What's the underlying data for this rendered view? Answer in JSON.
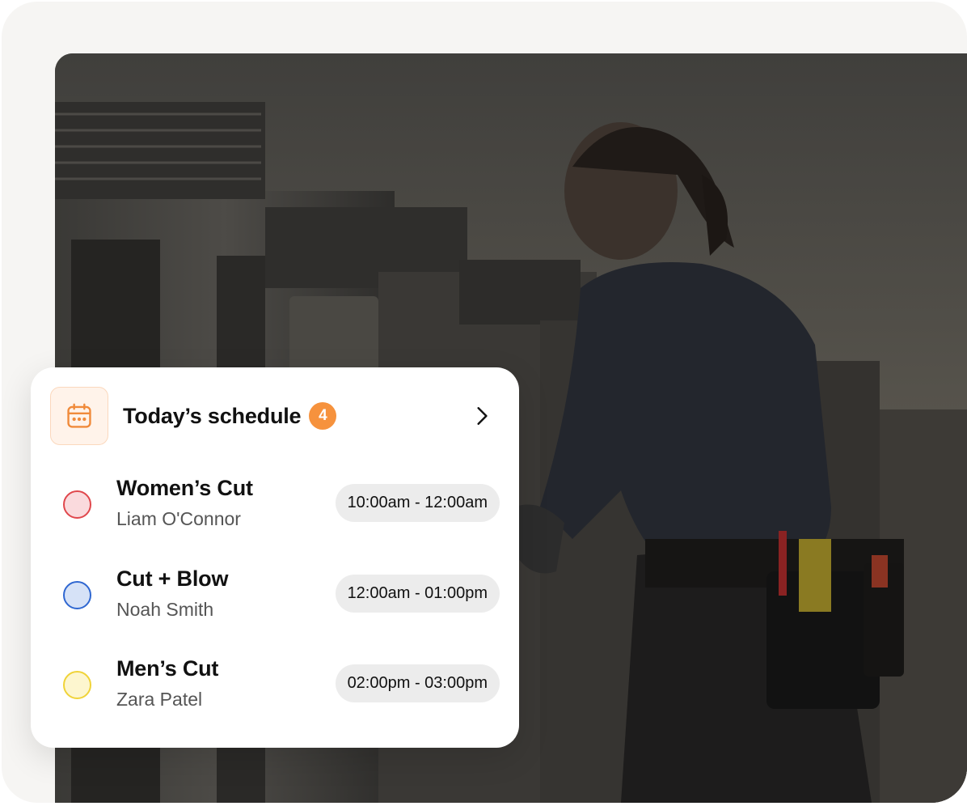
{
  "schedule": {
    "title": "Today’s schedule",
    "count": "4",
    "icons": {
      "calendar": "calendar-icon",
      "chevron": "chevron-right-icon"
    },
    "accent": "#f6923d",
    "appointments": [
      {
        "service": "Women’s Cut",
        "client": "Liam O'Connor",
        "time": "10:00am - 12:00am",
        "fill": "#fadadd",
        "stroke": "#e0474c"
      },
      {
        "service": "Cut + Blow",
        "client": "Noah Smith",
        "time": "12:00am - 01:00pm",
        "fill": "#d6e2f7",
        "stroke": "#2f67d1"
      },
      {
        "service": "Men’s Cut",
        "client": "Zara Patel",
        "time": "02:00pm - 03:00pm",
        "fill": "#fdf6cf",
        "stroke": "#f0d338"
      }
    ]
  }
}
